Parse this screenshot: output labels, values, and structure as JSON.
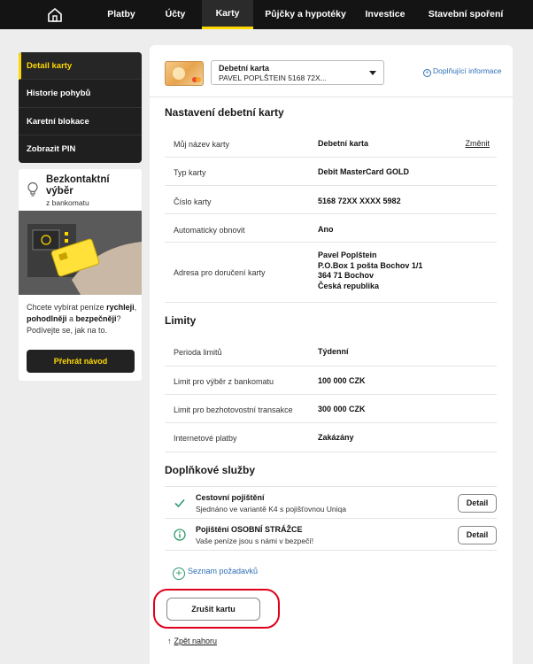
{
  "nav": {
    "items": [
      {
        "label": "Platby"
      },
      {
        "label": "Účty"
      },
      {
        "label": "Karty"
      },
      {
        "label": "Půjčky a hypotéky"
      },
      {
        "label": "Investice"
      },
      {
        "label": "Stavební spoření"
      }
    ],
    "active": "Karty"
  },
  "sidebar": {
    "items": [
      {
        "label": "Detail karty"
      },
      {
        "label": "Historie pohybů"
      },
      {
        "label": "Karetní blokace"
      },
      {
        "label": "Zobrazit PIN"
      }
    ],
    "promo": {
      "title": "Bezkontaktní výběr",
      "subtitle": "z bankomatu",
      "text_1": "Chcete vybírat peníze ",
      "text_bold_1": "rychleji",
      "text_2": ", ",
      "text_bold_2": "pohodlněji",
      "text_3": " a ",
      "text_bold_3": "bezpečněji",
      "text_4": "? Podívejte se, jak na to.",
      "button": "Přehrát návod"
    }
  },
  "card_selector": {
    "name": "Debetní karta",
    "number": "PAVEL POPLŠTEIN 5168 72X..."
  },
  "info_link": "Doplňující informace",
  "settings": {
    "title": "Nastavení debetní karty",
    "rows": [
      {
        "label": "Můj název karty",
        "value": "Debetní karta",
        "action": "Změnit"
      },
      {
        "label": "Typ karty",
        "value": "Debit MasterCard GOLD"
      },
      {
        "label": "Číslo karty",
        "value": "5168 72XX XXXX 5982"
      },
      {
        "label": "Automaticky obnovit",
        "value": "Ano"
      }
    ],
    "address": {
      "label": "Adresa pro doručení karty",
      "lines": [
        "Pavel Poplštein",
        "P.O.Box 1 pošta Bochov 1/1",
        "364 71  Bochov",
        "Česká republika"
      ]
    }
  },
  "limits": {
    "title": "Limity",
    "rows": [
      {
        "label": "Perioda limitů",
        "value": "Týdenní"
      },
      {
        "label": "Limit pro výběr z bankomatu",
        "value": "100 000 CZK"
      },
      {
        "label": "Limit pro bezhotovostní transakce",
        "value": "300 000 CZK"
      },
      {
        "label": "Internetové platby",
        "value": "Zakázány"
      }
    ]
  },
  "services": {
    "title": "Doplňkové služby",
    "items": [
      {
        "name": "Cestovní pojištění",
        "desc": "Sjednáno ve variantě K4 s pojišťovnou Uniqa",
        "button": "Detail",
        "icon": "check-icon",
        "color": "#2e9a6a"
      },
      {
        "name": "Pojištění OSOBNÍ STRÁŽCE",
        "desc": "Vaše peníze jsou s námi v bezpečí!",
        "button": "Detail",
        "icon": "info-icon",
        "color": "#2e9a6a"
      }
    ],
    "add_request": "Seznam požadavků"
  },
  "cancel_button": "Zrušit kartu",
  "back_to_top": "Zpět nahoru",
  "colors": {
    "accent": "#ffd800",
    "link": "#2e6fb7",
    "highlight": "#e0001b"
  }
}
